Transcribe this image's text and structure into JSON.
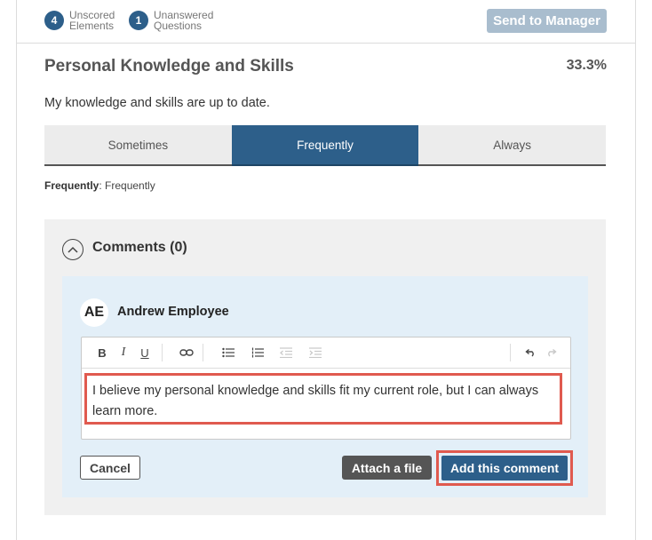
{
  "header": {
    "unscored": {
      "count": "4",
      "label": "Unscored Elements"
    },
    "unanswered": {
      "count": "1",
      "label": "Unanswered Questions"
    },
    "send_button": "Send to Manager",
    "send_button_color": "#a9bdce"
  },
  "section": {
    "title": "Personal Knowledge and Skills",
    "score": "33.3%",
    "question": "My  knowledge and skills are up to date."
  },
  "options": {
    "items": [
      "Sometimes",
      "Frequently",
      "Always"
    ],
    "selected": "Frequently",
    "active_color": "#2d5f8a"
  },
  "selection": {
    "label": "Frequently",
    "separator": ":",
    "value": "Frequently"
  },
  "comments": {
    "title": "Comments (0)",
    "collapse_icon": "chevron-up-icon",
    "user": {
      "initials": "AE",
      "name": "Andrew Employee"
    },
    "toolbar": {
      "icons": [
        "bold-icon",
        "italic-icon",
        "underline-icon",
        "link-icon",
        "bullet-list-icon",
        "numbered-list-icon",
        "outdent-icon",
        "indent-icon",
        "undo-icon",
        "redo-icon"
      ],
      "bold_glyph": "B",
      "italic_glyph": "I",
      "underline_glyph": "U"
    },
    "text": "I believe my personal knowledge and skills fit my current role, but I can always learn more.",
    "cancel": "Cancel",
    "attach": "Attach a file",
    "add": "Add this comment",
    "highlight_color": "#e05a4f"
  }
}
